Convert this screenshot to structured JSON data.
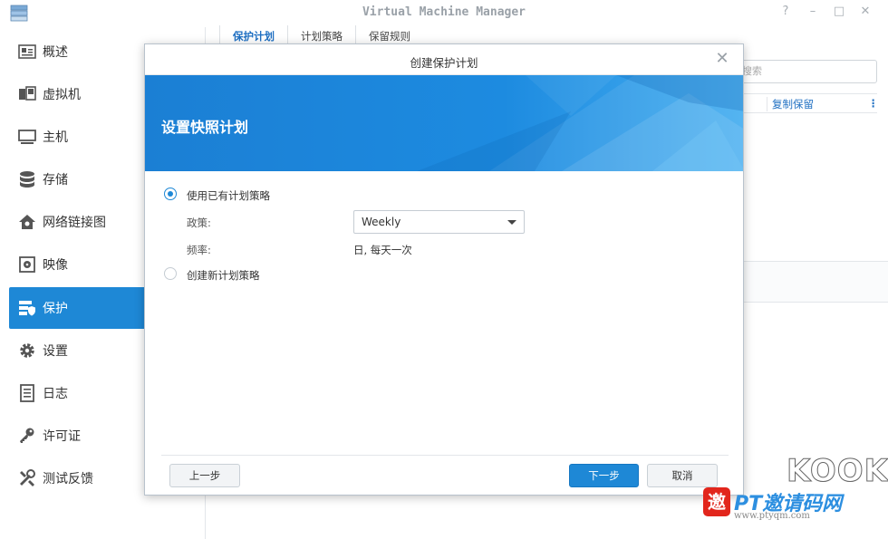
{
  "app": {
    "title": "Virtual Machine Manager",
    "window_controls": [
      "?",
      "–",
      "□",
      "✕"
    ]
  },
  "sidebar": {
    "items": [
      {
        "label": "概述",
        "icon": "overview-icon"
      },
      {
        "label": "虚拟机",
        "icon": "virtual-machine-icon"
      },
      {
        "label": "主机",
        "icon": "host-monitor-icon"
      },
      {
        "label": "存储",
        "icon": "storage-database-icon"
      },
      {
        "label": "网络链接图",
        "icon": "network-home-icon"
      },
      {
        "label": "映像",
        "icon": "image-disc-icon"
      },
      {
        "label": "保护",
        "icon": "protection-icon",
        "active": true
      },
      {
        "label": "设置",
        "icon": "gear-icon"
      },
      {
        "label": "日志",
        "icon": "log-list-icon"
      },
      {
        "label": "许可证",
        "icon": "key-icon"
      },
      {
        "label": "测试反馈",
        "icon": "wrench-icon"
      }
    ]
  },
  "tabs": [
    "保护计划",
    "计划策略",
    "保留规则"
  ],
  "background": {
    "search_placeholder": "搜索",
    "column_header": "复制保留",
    "more": "⋮"
  },
  "dialog": {
    "title": "创建保护计划",
    "close": "✕",
    "heading": "设置快照计划",
    "option_existing": "使用已有计划策略",
    "policy_label": "政策:",
    "policy_value": "Weekly",
    "frequency_label": "频率:",
    "frequency_value": "日, 每天一次",
    "option_new": "创建新计划策略",
    "btn_prev": "上一步",
    "btn_next": "下一步",
    "btn_cancel": "取消"
  },
  "watermark": {
    "brand": "KOOK",
    "badge": "邀",
    "site": "PT邀请码网",
    "url": "www.ptyqm.com"
  },
  "colors": {
    "accent": "#1e88d6",
    "banner": "#1b7fd4"
  }
}
